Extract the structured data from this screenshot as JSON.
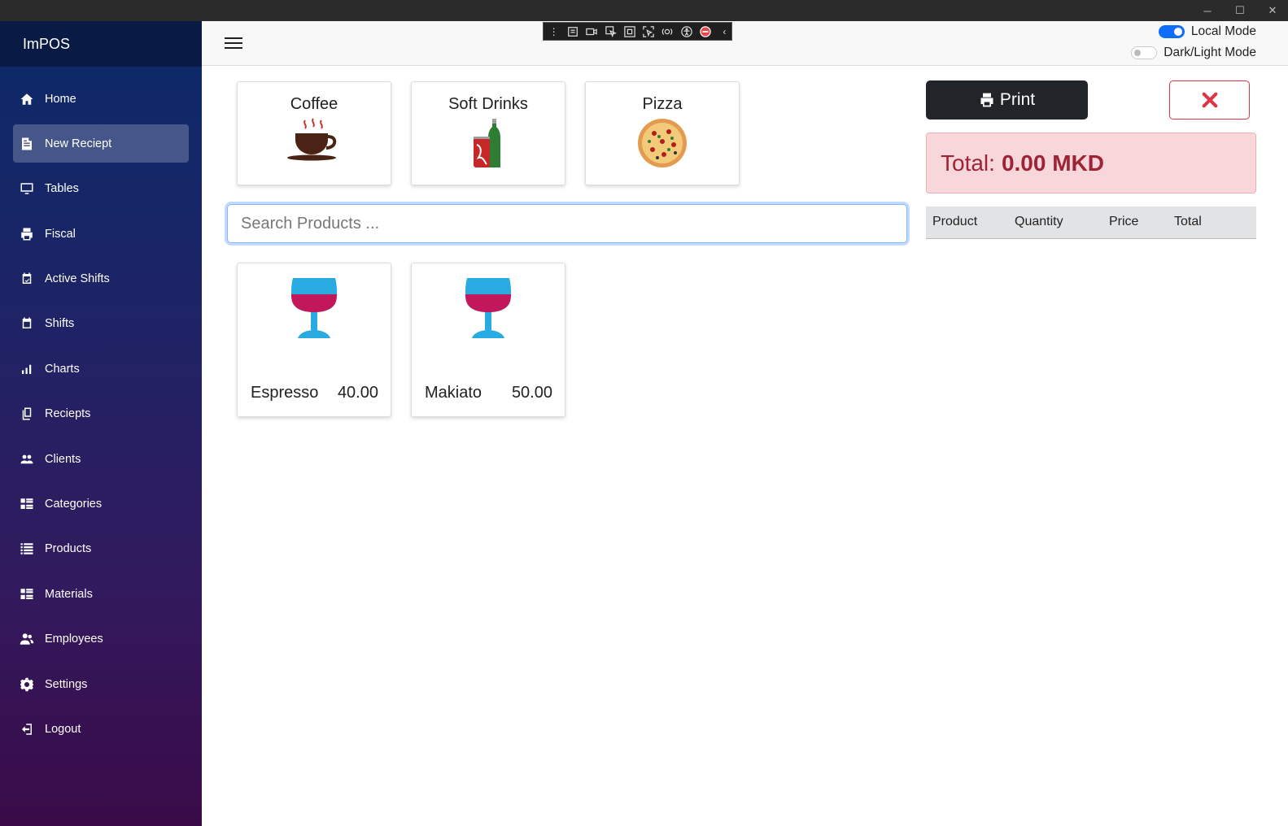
{
  "app": {
    "brand": "ImPOS"
  },
  "window": {
    "minimize": "─",
    "maximize": "☐",
    "close": "✕"
  },
  "sidebar": {
    "items": [
      {
        "label": "Home",
        "icon": "home-icon",
        "active": false
      },
      {
        "label": "New Reciept",
        "icon": "receipt-icon",
        "active": true
      },
      {
        "label": "Tables",
        "icon": "monitor-icon",
        "active": false
      },
      {
        "label": "Fiscal",
        "icon": "printer-icon",
        "active": false
      },
      {
        "label": "Active Shifts",
        "icon": "calendar-check-icon",
        "active": false
      },
      {
        "label": "Shifts",
        "icon": "calendar-icon",
        "active": false
      },
      {
        "label": "Charts",
        "icon": "bar-chart-icon",
        "active": false
      },
      {
        "label": "Reciepts",
        "icon": "copy-icon",
        "active": false
      },
      {
        "label": "Clients",
        "icon": "people-icon",
        "active": false
      },
      {
        "label": "Categories",
        "icon": "category-list-icon",
        "active": false
      },
      {
        "label": "Products",
        "icon": "list-icon",
        "active": false
      },
      {
        "label": "Materials",
        "icon": "category-list-icon",
        "active": false
      },
      {
        "label": "Employees",
        "icon": "users-icon",
        "active": false
      },
      {
        "label": "Settings",
        "icon": "gear-icon",
        "active": false
      },
      {
        "label": "Logout",
        "icon": "logout-icon",
        "active": false
      }
    ]
  },
  "header": {
    "local_mode": {
      "label": "Local Mode",
      "on": true
    },
    "theme_mode": {
      "label": "Dark/Light Mode",
      "on": false
    }
  },
  "categories": [
    {
      "label": "Coffee",
      "icon": "coffee-cup-icon"
    },
    {
      "label": "Soft Drinks",
      "icon": "soft-drinks-icon"
    },
    {
      "label": "Pizza",
      "icon": "pizza-icon"
    }
  ],
  "search": {
    "placeholder": "Search Products ...",
    "value": ""
  },
  "products": [
    {
      "name": "Espresso",
      "price": "40.00",
      "icon": "wine-glass-icon"
    },
    {
      "name": "Makiato",
      "price": "50.00",
      "icon": "wine-glass-icon"
    }
  ],
  "receipt": {
    "print_label": "Print",
    "total_label": "Total:",
    "total_value": "0.00 MKD",
    "columns": [
      "Product",
      "Quantity",
      "Price",
      "Total"
    ],
    "rows": []
  },
  "colors": {
    "accent": "#0d6efd",
    "danger": "#dc3545",
    "print_button": "#212529",
    "total_bg": "#f8d7da"
  }
}
